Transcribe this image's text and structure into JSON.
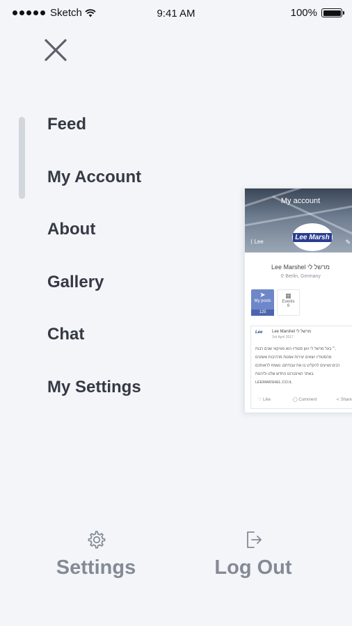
{
  "status_bar": {
    "carrier": "Sketch",
    "time": "9:41 AM",
    "battery": "100%",
    "battery_level": 1.0
  },
  "menu": {
    "items": [
      {
        "label": "Feed"
      },
      {
        "label": "My Account"
      },
      {
        "label": "About"
      },
      {
        "label": "Gallery"
      },
      {
        "label": "Chat"
      },
      {
        "label": "My Settings"
      }
    ]
  },
  "preview": {
    "title": "My account",
    "profile_name": "Lee Marshel מרשל לי",
    "location": "Berlin, Germany",
    "logo_text": "Lee Marsh",
    "stats": [
      {
        "label": "My posts",
        "value": "125"
      },
      {
        "label": "Events",
        "value": "6"
      }
    ],
    "post": {
      "author": "Lee Marshel מרשל לי",
      "date": "3rd April 2017",
      "lines": [
        "״ בעל מרשל לי ויגון סטודיו הוא מוזיקאי שנים רבות,",
        "מהסטודיו יוצאים יצירות אמנות מרהיבות ואומנים",
        "רבים מגיעים להקליט בו את עבודתם. נשמח לראותכם",
        "באתר האינטרנט החדש שלנו וליהנות",
        "LEEMARSHEL.CO.IL"
      ],
      "actions": {
        "like": "Like",
        "comment": "Comment",
        "share": "Share"
      }
    }
  },
  "bottom": {
    "settings_label": "Settings",
    "logout_label": "Log Out"
  }
}
